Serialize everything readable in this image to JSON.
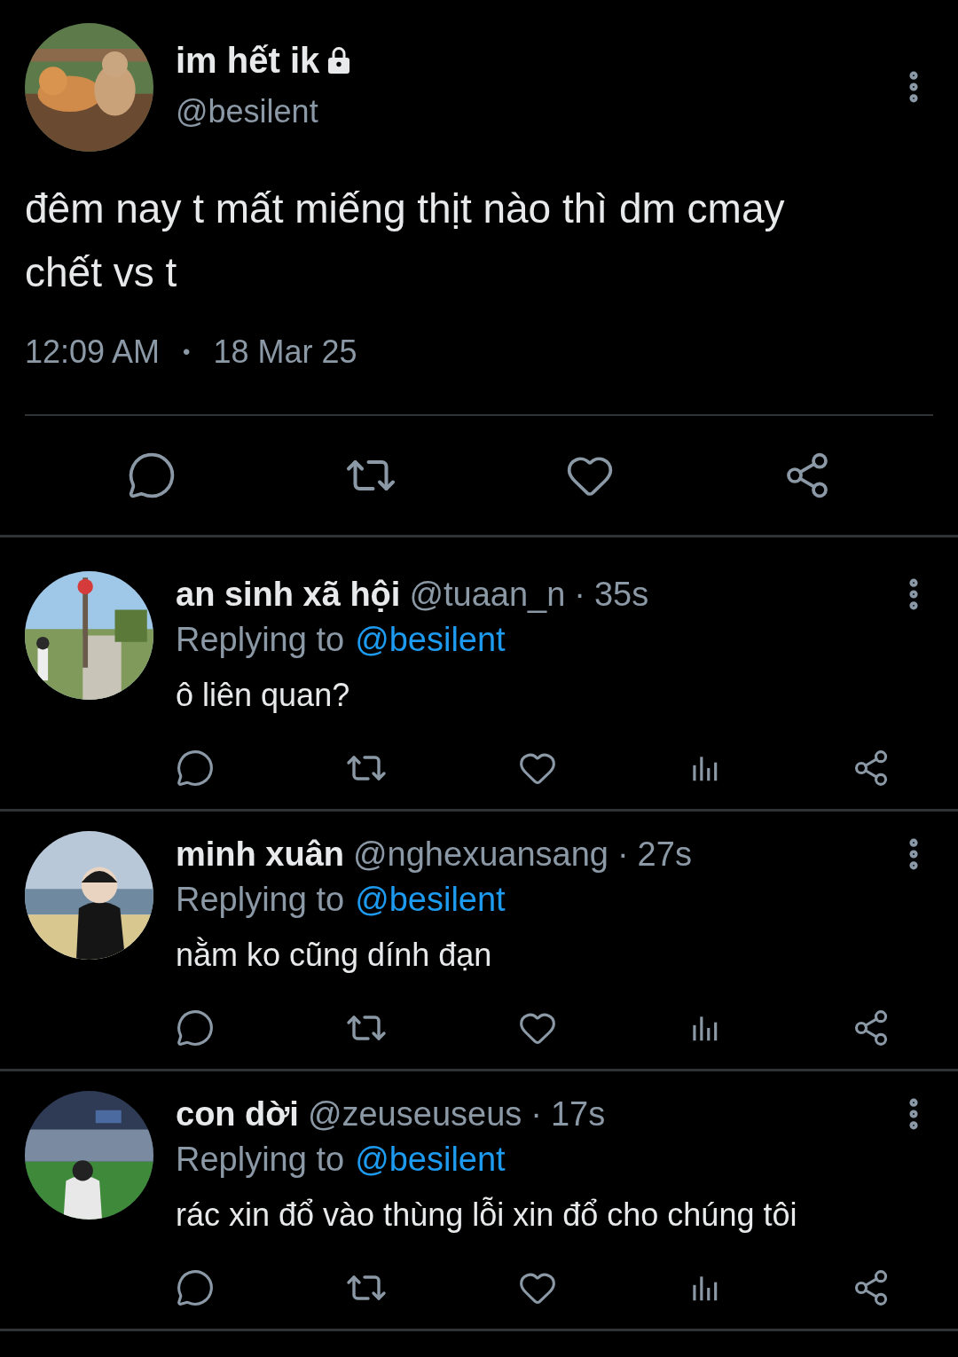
{
  "tweet": {
    "name": "im hết ik",
    "protected": true,
    "handle": "@besilent",
    "text": "đêm nay t mất miếng thịt nào thì dm cmay chết vs t",
    "time": "12:09 AM",
    "separator": "•",
    "date": "18 Mar 25"
  },
  "replies": [
    {
      "name": "an sinh xã hội",
      "handle": "@tuaan_n",
      "dot": "·",
      "age": "35s",
      "replying_prefix": "Replying to",
      "replying_handle": "@besilent",
      "text": "ô liên quan?"
    },
    {
      "name": "minh xuân",
      "handle": "@nghexuansang",
      "dot": "·",
      "age": "27s",
      "replying_prefix": "Replying to",
      "replying_handle": "@besilent",
      "text": "nằm ko cũng dính đạn"
    },
    {
      "name": "con dời",
      "handle": "@zeuseuseus",
      "dot": "·",
      "age": "17s",
      "replying_prefix": "Replying to",
      "replying_handle": "@besilent",
      "text": "rác xin đổ vào thùng lỗi xin đổ cho chúng tôi"
    }
  ]
}
